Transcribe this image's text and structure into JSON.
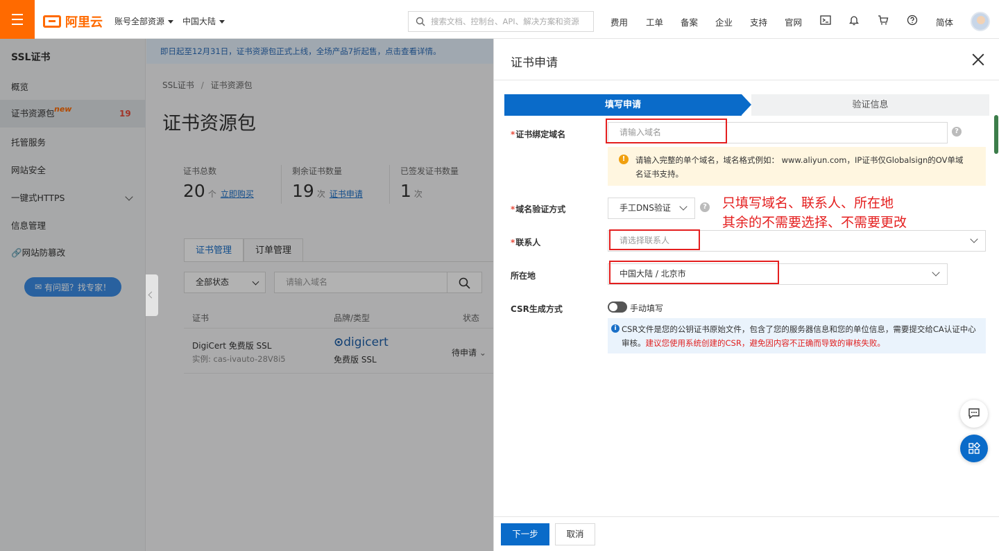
{
  "topbar": {
    "brand": "阿里云",
    "account_scope": "账号全部资源",
    "region": "中国大陆",
    "search_placeholder": "搜索文档、控制台、API、解决方案和资源",
    "nav": [
      "费用",
      "工单",
      "备案",
      "企业",
      "支持",
      "官网"
    ],
    "lang": "简体",
    "icons": [
      "terminal-icon",
      "bell-icon",
      "cart-icon",
      "help-icon"
    ]
  },
  "sidebar": {
    "title": "SSL证书",
    "items": [
      {
        "label": "概览"
      },
      {
        "label": "证书资源包",
        "badge": "new",
        "count": "19"
      },
      {
        "label": "托管服务"
      },
      {
        "label": "网站安全"
      },
      {
        "label": "一键式HTTPS"
      },
      {
        "label": "信息管理"
      },
      {
        "label": "网站防篡改"
      }
    ],
    "help_button": "有问题？找专家！"
  },
  "main": {
    "banner": "即日起至12月31日，证书资源包正式上线，全场产品7折起售，点击查看详情。",
    "breadcrumb": [
      "SSL证书",
      "证书资源包"
    ],
    "title": "证书资源包",
    "stats": [
      {
        "label": "证书总数",
        "value": "20",
        "unit": "个",
        "link": "立即购买"
      },
      {
        "label": "剩余证书数量",
        "value": "19",
        "unit": "次",
        "link": "证书申请"
      },
      {
        "label": "已签发证书数量",
        "value": "1",
        "unit": "次",
        "link": ""
      }
    ],
    "tabs": [
      "证书管理",
      "订单管理"
    ],
    "filter": {
      "status": "全部状态",
      "placeholder": "请输入域名"
    },
    "table": {
      "headers": [
        "证书",
        "品牌/类型",
        "状态"
      ],
      "rows": [
        {
          "name": "DigiCert 免费版 SSL",
          "instance": "实例: cas-ivauto-28V8i5",
          "brand_logo": "digicert",
          "type": "免费版 SSL",
          "status": "待申请"
        }
      ]
    }
  },
  "panel": {
    "title": "证书申请",
    "steps": [
      "填写申请",
      "验证信息"
    ],
    "fields": {
      "domain": {
        "label": "证书绑定域名",
        "placeholder": "请输入域名"
      },
      "domain_tip": "请输入完整的单个域名，域名格式例如： www.aliyun.com，IP证书仅Globalsign的OV单域名证书支持。",
      "verify": {
        "label": "域名验证方式",
        "value": "手工DNS验证"
      },
      "contact": {
        "label": "联系人",
        "placeholder": "请选择联系人"
      },
      "location": {
        "label": "所在地",
        "value": "中国大陆 / 北京市"
      },
      "csr": {
        "label": "CSR生成方式",
        "value": "手动填写"
      },
      "csr_tip": "CSR文件是您的公钥证书原始文件，包含了您的服务器信息和您的单位信息，需要提交给CA认证中心审核。",
      "csr_warn": "建议您使用系统创建的CSR，避免因内容不正确而导致的审核失败。"
    },
    "annotation": [
      "只填写域名、联系人、所在地",
      "其余的不需要选择、不需要更改"
    ],
    "buttons": {
      "next": "下一步",
      "cancel": "取消"
    }
  },
  "colors": {
    "brand": "#ff6a00",
    "primary": "#0a6bc9",
    "annotation": "#e41e1e"
  }
}
